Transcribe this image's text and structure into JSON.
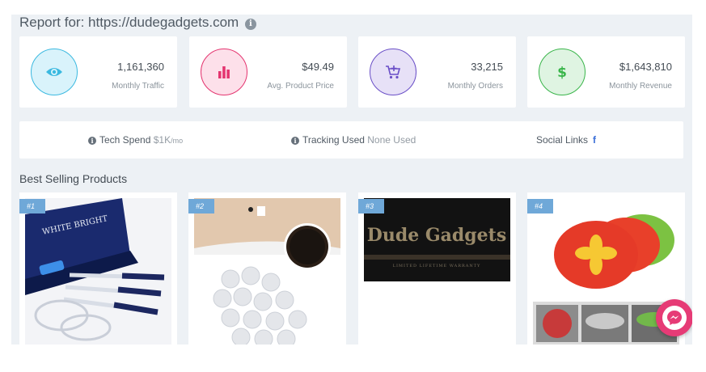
{
  "report": {
    "title": "Report for: https://dudegadgets.com",
    "info_glyph": "i"
  },
  "stats": [
    {
      "value": "1,161,360",
      "label": "Monthly Traffic",
      "icon": "eye-icon",
      "color": "#3bb9e0",
      "bg": "#d9f3fb"
    },
    {
      "value": "$49.49",
      "label": "Avg. Product Price",
      "icon": "bar-chart-icon",
      "color": "#e4346f",
      "bg": "#fde0ea"
    },
    {
      "value": "33,215",
      "label": "Monthly Orders",
      "icon": "cart-icon",
      "color": "#6a4fc7",
      "bg": "#e7e1f7"
    },
    {
      "value": "$1,643,810",
      "label": "Monthly Revenue",
      "icon": "dollar-icon",
      "color": "#39b54a",
      "bg": "#dff4e2"
    }
  ],
  "techbar": {
    "tech_label": "Tech Spend",
    "tech_value": "$1K",
    "tech_unit": "/mo",
    "tracking_label": "Tracking Used",
    "tracking_value": "None Used",
    "social_label": "Social Links",
    "social_icon": "f"
  },
  "best_selling": {
    "heading": "Best Selling Products",
    "products": [
      {
        "rank": "#1",
        "image": "teeth-whitening-kit",
        "brand_text": "WHITE BRIGHT"
      },
      {
        "rank": "#2",
        "image": "charcoal-patches"
      },
      {
        "rank": "#3",
        "image": "dude-gadgets-banner",
        "banner_text": "Dude Gadgets",
        "banner_sub": "LIMITED LIFETIME WARRANTY"
      },
      {
        "rank": "#4",
        "image": "spill-stopper-lids"
      }
    ]
  },
  "messenger": {
    "icon": "messenger-icon"
  }
}
